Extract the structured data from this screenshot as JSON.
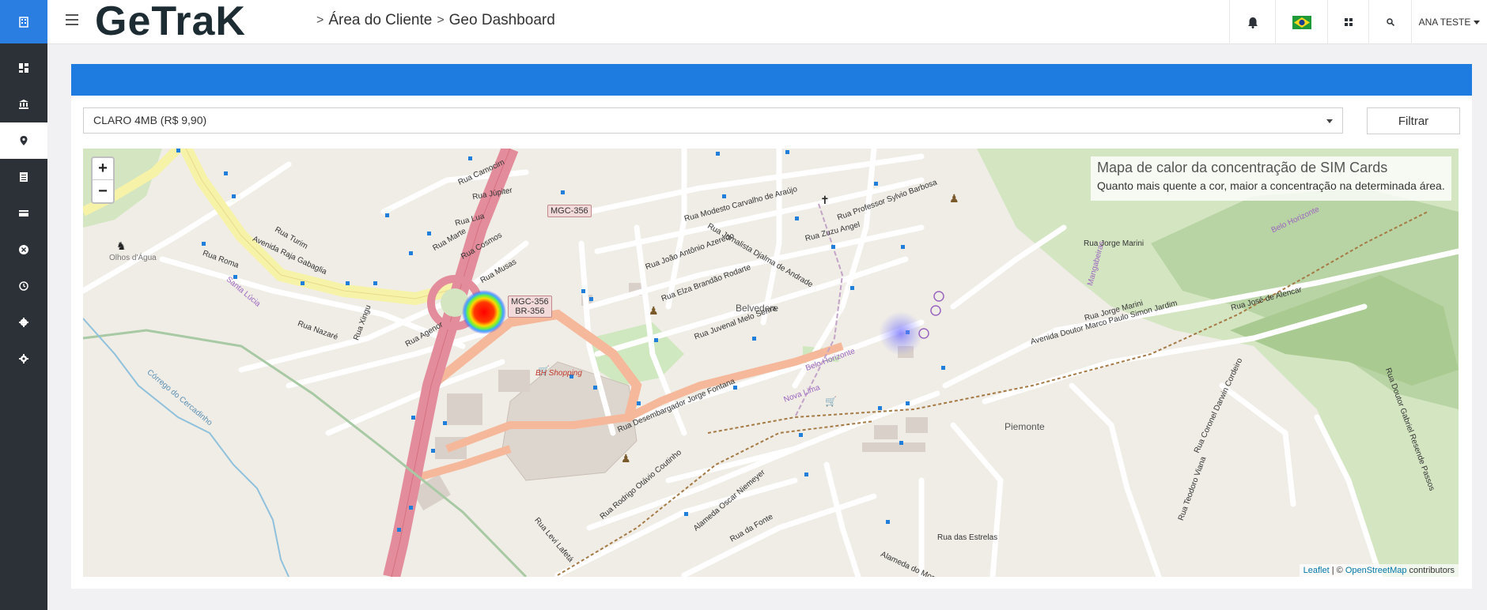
{
  "app": {
    "logo_text": "GeTraK",
    "breadcrumb": [
      "Área do Cliente",
      "Geo Dashboard"
    ],
    "breadcrumb_sep": ">"
  },
  "topbar": {
    "user_name": "ANA TESTE",
    "icons": [
      "bell-icon",
      "brazil-flag-icon",
      "grid-icon",
      "search-icon"
    ]
  },
  "sidebar": {
    "items": [
      "dashboard-icon",
      "bank-icon",
      "map-marker-icon",
      "document-icon",
      "card-icon",
      "close-circle-icon",
      "history-icon",
      "settings-icon",
      "gear-icon"
    ],
    "active_index": 2
  },
  "filter": {
    "selected_plan": "CLARO 4MB (R$ 9,90)",
    "button_label": "Filtrar"
  },
  "map": {
    "zoom_in": "+",
    "zoom_out": "−",
    "legend_title": "Mapa de calor da concentração de SIM Cards",
    "legend_subtitle": "Quanto mais quente a cor, maior a concentração na determinada área.",
    "attribution_leaflet": "Leaflet",
    "attribution_sep": " | © ",
    "attribution_osm": "OpenStreetMap",
    "attribution_suffix": " contributors",
    "labels": {
      "mgc356_top": "MGC-356",
      "mgc356_mid": "MGC-356",
      "br356": "BR-356",
      "belvedere": "Belvedere",
      "piemonte": "Piemonte",
      "bh_shopping": "BH Shopping",
      "olhos_dagua": "Olhos d'Água",
      "santa_lucia": "Santa Lúcia",
      "belo_horizonte_1": "Belo Horizonte",
      "belo_horizonte_2": "Belo Horizonte",
      "nova_lima": "Nova Lima",
      "corrego": "Córrego do Cercadinho",
      "mangabeiras": "Mangabeiras",
      "av_raja": "Avenida Raja Gabaglia",
      "av_marco_paulo": "Avenida Doutor Marco Paulo Simon Jardim",
      "rua_jorge_marini": "Rua Jorge Marini",
      "rua_jose_alencar": "Rua José de Alencar",
      "rua_desembargador": "Rua Desembargador Jorge Fontana",
      "rua_juvenal": "Rua Juvenal Melo Senra",
      "rua_joao_antonio": "Rua João Antônio Azeredo",
      "rua_elza": "Rua Elza Brandão Rodarte",
      "rua_modesto": "Rua Modesto Carvalho de Araújo",
      "rua_zuzu": "Rua Zuzu Angel",
      "rua_professor": "Rua Professor Sylvio Barbosa",
      "rua_jornalista": "Rua Jornalista Djalma de Andrade",
      "rua_roma": "Rua Roma",
      "rua_turim": "Rua Turim",
      "rua_nazare": "Rua Nazaré",
      "rua_xingu": "Rua Xingu",
      "rua_agenor": "Rua Agenor",
      "rua_musas": "Rua Musas",
      "rua_cosmos": "Rua Cosmos",
      "rua_marte": "Rua Marte",
      "rua_lua": "Rua Lua",
      "rua_jupiter": "Rua Júpiter",
      "rua_camocim": "Rua Camocim",
      "rua_rodrigo": "Rua Rodrigo Otávio Coutinho",
      "alameda_oscar": "Alameda Oscar Niemeyer",
      "rua_da_fonte": "Rua da Fonte",
      "rua_das_estrelas": "Rua das Estrelas",
      "rua_levi": "Rua Levi Lafetá",
      "alameda_morro": "Alameda do Morro",
      "rua_coronel": "Rua Coronel Darwin Cordeiro",
      "rua_teodoro": "Rua Teodoro Viana",
      "rua_gabriel": "Rua Doutor Gabriel Resende Passos"
    }
  }
}
